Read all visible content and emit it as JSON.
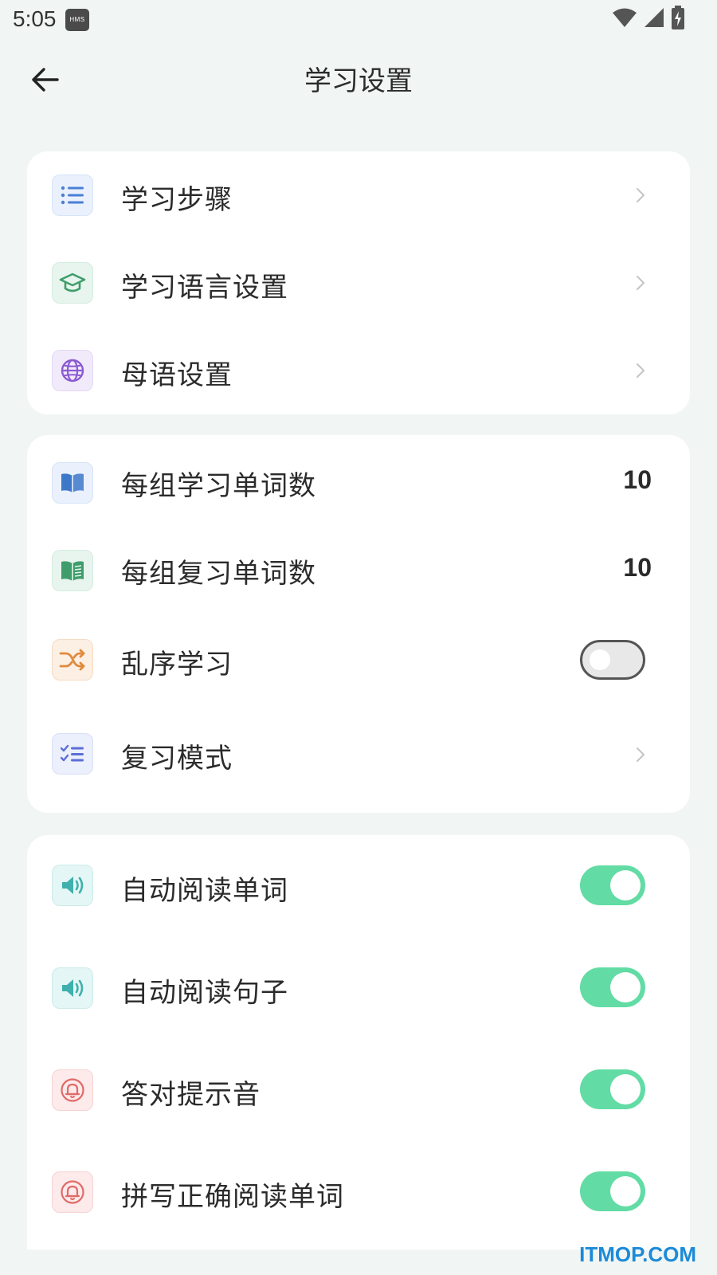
{
  "status_bar": {
    "time": "5:05",
    "hms_badge": "HMS"
  },
  "header": {
    "title": "学习设置"
  },
  "groups": [
    {
      "items": [
        {
          "label": "学习步骤",
          "icon": "list-icon",
          "icon_color": "#4a7fd6",
          "icon_bg": "#eaf1fd"
        },
        {
          "label": "学习语言设置",
          "icon": "graduation-cap-icon",
          "icon_color": "#3f9d6b",
          "icon_bg": "#e8f5ee"
        },
        {
          "label": "母语设置",
          "icon": "globe-icon",
          "icon_color": "#8b5bd1",
          "icon_bg": "#f1eafb"
        }
      ]
    },
    {
      "items": [
        {
          "label": "每组学习单词数",
          "value": "10",
          "icon": "book-icon",
          "icon_color": "#3e78c9",
          "icon_bg": "#eaf1fd"
        },
        {
          "label": "每组复习单词数",
          "value": "10",
          "icon": "open-book-icon",
          "icon_color": "#3f9d6b",
          "icon_bg": "#e8f5ee"
        },
        {
          "label": "乱序学习",
          "toggle": false,
          "icon": "shuffle-icon",
          "icon_color": "#e08a3e",
          "icon_bg": "#fcefe3"
        },
        {
          "label": "复习模式",
          "icon": "checklist-icon",
          "icon_color": "#5b6fd6",
          "icon_bg": "#eceffc"
        }
      ]
    },
    {
      "items": [
        {
          "label": "自动阅读单词",
          "toggle": true,
          "icon": "speaker-icon",
          "icon_color": "#3fb0ad",
          "icon_bg": "#e4f6f5"
        },
        {
          "label": "自动阅读句子",
          "toggle": true,
          "icon": "speaker-icon",
          "icon_color": "#3fb0ad",
          "icon_bg": "#e4f6f5"
        },
        {
          "label": "答对提示音",
          "toggle": true,
          "icon": "bell-icon",
          "icon_color": "#e06a6a",
          "icon_bg": "#fdeaea"
        },
        {
          "label": "拼写正确阅读单词",
          "toggle": true,
          "icon": "bell-icon",
          "icon_color": "#e06a6a",
          "icon_bg": "#fdeaea"
        }
      ]
    }
  ],
  "colors": {
    "toggle_on": "#62dca4",
    "background": "#f1f6f5",
    "card": "#ffffff"
  },
  "watermark": "ITMOP.COM"
}
